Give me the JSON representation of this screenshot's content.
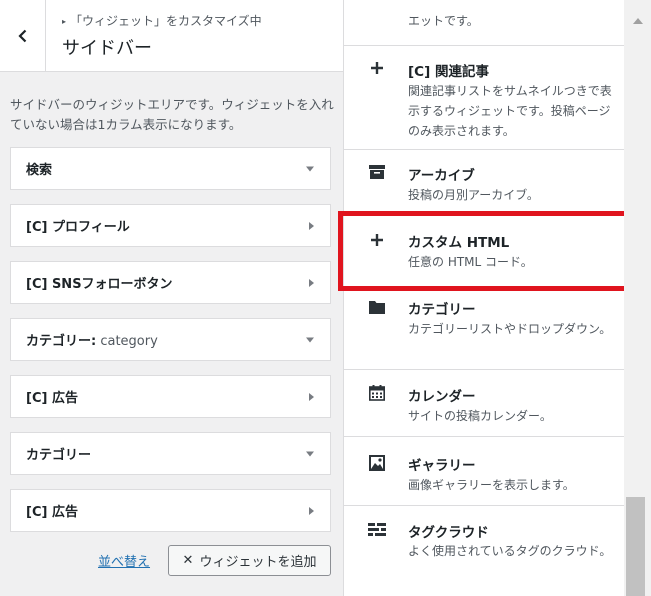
{
  "header": {
    "breadcrumb": "「ウィジェット」をカスタマイズ中",
    "title": "サイドバー"
  },
  "description": "サイドバーのウィジットエリアです。ウィジェットを入れていない場合は1カラム表示になります。",
  "widgets": [
    {
      "label": "検索",
      "sub": "",
      "toggle": "down"
    },
    {
      "label": "[C] プロフィール",
      "sub": "",
      "toggle": "right"
    },
    {
      "label": "[C] SNSフォローボタン",
      "sub": "",
      "toggle": "right"
    },
    {
      "label": "カテゴリー:",
      "sub": " category",
      "toggle": "down"
    },
    {
      "label": "[C] 広告",
      "sub": "",
      "toggle": "right"
    },
    {
      "label": "カテゴリー",
      "sub": "",
      "toggle": "down"
    },
    {
      "label": "[C] 広告",
      "sub": "",
      "toggle": "right"
    }
  ],
  "actions": {
    "reorder": "並べ替え",
    "add_widget": "ウィジェットを追加"
  },
  "available_widgets": [
    {
      "icon": "none",
      "name": "",
      "desc": "エットです。"
    },
    {
      "icon": "plus-icon",
      "name": "[C] 関連記事",
      "desc": "関連記事リストをサムネイルつきで表示するウィジェットです。投稿ページのみ表示されます。"
    },
    {
      "icon": "archive-icon",
      "name": "アーカイブ",
      "desc": "投稿の月別アーカイブ。"
    },
    {
      "icon": "plus-icon",
      "name": "カスタム HTML",
      "desc": "任意の HTML コード。"
    },
    {
      "icon": "folder-icon",
      "name": "カテゴリー",
      "desc": "カテゴリーリストやドロップダウン。"
    },
    {
      "icon": "calendar-icon",
      "name": "カレンダー",
      "desc": "サイトの投稿カレンダー。"
    },
    {
      "icon": "gallery-icon",
      "name": "ギャラリー",
      "desc": "画像ギャラリーを表示します。"
    },
    {
      "icon": "tag-cloud-icon",
      "name": "タグクラウド",
      "desc": "よく使用されているタグのクラウド。"
    }
  ],
  "colors": {
    "highlight": "#e0141e",
    "link": "#2271b1"
  }
}
